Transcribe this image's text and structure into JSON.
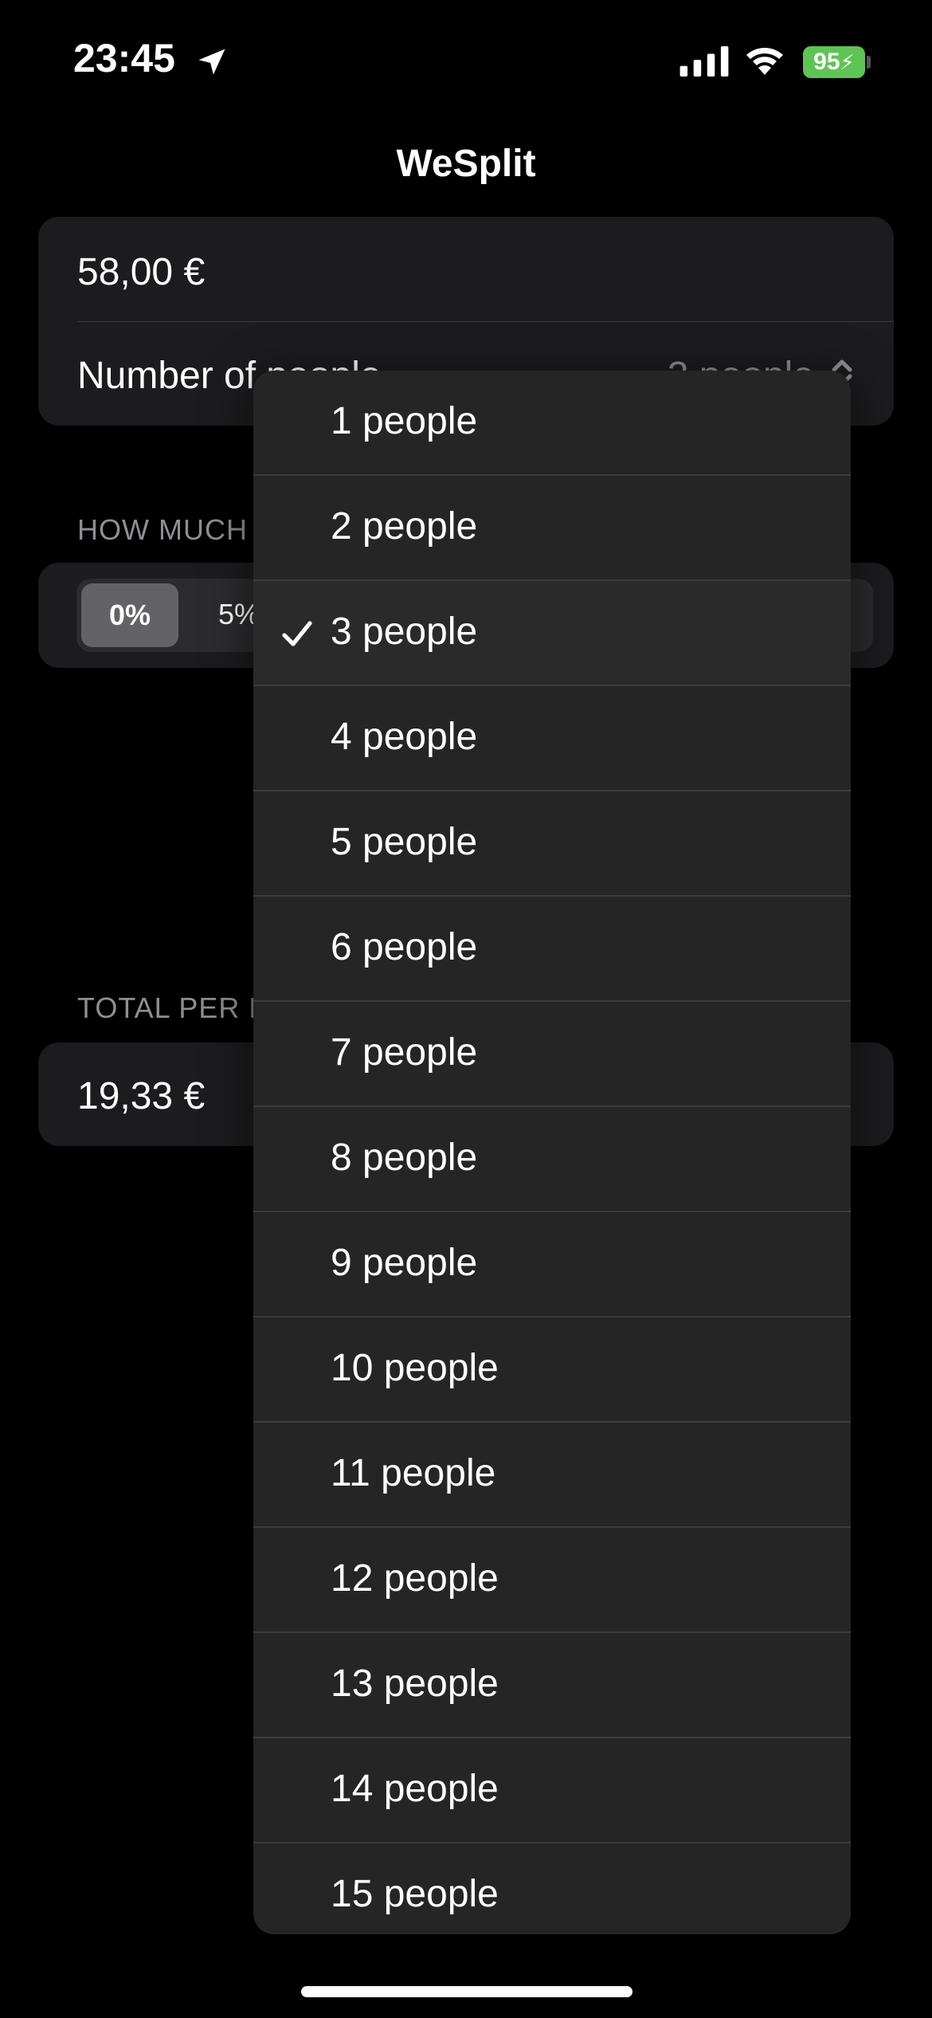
{
  "status_bar": {
    "time": "23:45",
    "battery": "95",
    "icons": [
      "location-arrow-icon",
      "cellular-signal-icon",
      "wifi-icon",
      "battery-charging-icon"
    ]
  },
  "nav": {
    "title": "WeSplit"
  },
  "form": {
    "amount": "58,00 €",
    "people_label": "Number of people",
    "people_value": "3 people",
    "tip_header": "HOW MUCH",
    "tip_selected": "0%",
    "tip_next": "5%",
    "total_header": "TOTAL PER P",
    "total_value": "19,33 €"
  },
  "menu": {
    "selected_index": 2,
    "items": [
      "1 people",
      "2 people",
      "3 people",
      "4 people",
      "5 people",
      "6 people",
      "7 people",
      "8 people",
      "9 people",
      "10 people",
      "11 people",
      "12 people",
      "13 people",
      "14 people",
      "15 people"
    ]
  },
  "colors": {
    "background": "#000000",
    "card": "#1c1c1e",
    "menu": "#252526",
    "secondary_text": "#8e8e93",
    "battery": "#5fc455"
  }
}
